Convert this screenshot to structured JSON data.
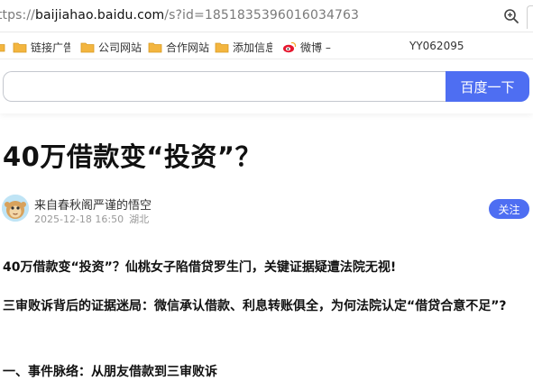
{
  "browser": {
    "url_prefix": "https://",
    "url_host": "baijiahao.baidu.com",
    "url_rest": "/s?id=1851835396016034763",
    "zoom_icon": "zoom-in-icon"
  },
  "bookmarks": {
    "items": [
      {
        "label": "链接广告",
        "icon": "folder-icon"
      },
      {
        "label": "公司网站",
        "icon": "folder-icon"
      },
      {
        "label": "合作网站",
        "icon": "folder-icon"
      },
      {
        "label": "添加信息",
        "icon": "folder-icon"
      },
      {
        "label": "微博 –",
        "icon": "weibo-icon"
      }
    ],
    "user": "YY062095"
  },
  "search": {
    "value": "",
    "button_label": "百度一下"
  },
  "article": {
    "title": "40万借款变“投资”？",
    "author": "来自春秋阁严谨的悟空",
    "date": "2025-12-18 16:50",
    "location": "湖北",
    "follow_label": "关注",
    "paragraphs": [
      "40万借款变“投资”？仙桃女子陷借贷罗生门，关键证据疑遭法院无视!",
      "三审败诉背后的证据迷局：微信承认借款、利息转账俱全，为何法院认定“借贷合意不足”?",
      "一、事件脉络：从朋友借款到三审败诉"
    ]
  },
  "colors": {
    "accent": "#4e6ef2",
    "folder": "#f3b53f",
    "weibo": "#e6162d"
  }
}
